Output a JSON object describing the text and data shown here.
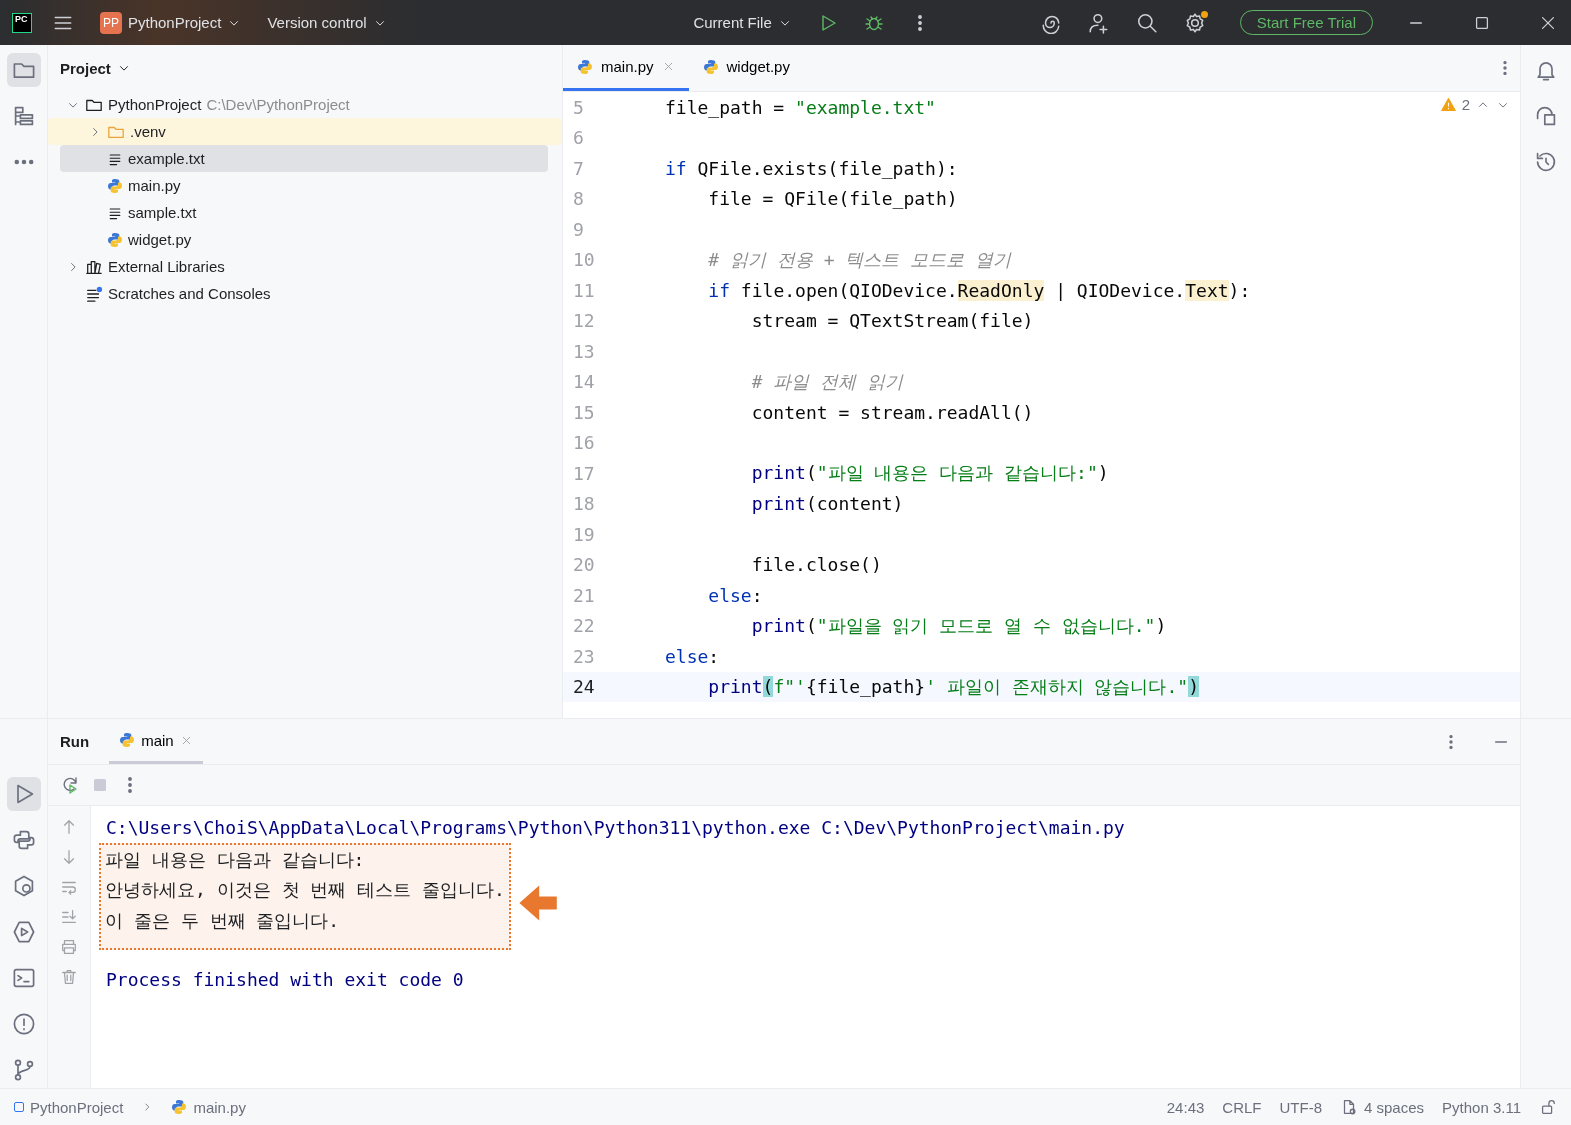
{
  "title_bar": {
    "app_logo": "PC",
    "project_badge": "PP",
    "project": "PythonProject",
    "vcs": "Version control",
    "run_config": "Current File",
    "trial_button": "Start Free Trial"
  },
  "project_panel": {
    "title": "Project",
    "tree": [
      {
        "name": "PythonProject",
        "path": "C:\\Dev\\PythonProject",
        "kind": "project",
        "expanded": true,
        "selected": false,
        "highlighted": false,
        "children": [
          {
            "name": ".venv",
            "kind": "folder",
            "expanded": false,
            "selected": false,
            "highlighted": true
          },
          {
            "name": "example.txt",
            "kind": "text",
            "selected": true,
            "highlighted": false
          },
          {
            "name": "main.py",
            "kind": "python",
            "selected": false,
            "highlighted": false
          },
          {
            "name": "sample.txt",
            "kind": "text",
            "selected": false,
            "highlighted": false
          },
          {
            "name": "widget.py",
            "kind": "python",
            "selected": false,
            "highlighted": false
          }
        ]
      },
      {
        "name": "External Libraries",
        "kind": "library",
        "expanded": false,
        "selected": false,
        "highlighted": false
      },
      {
        "name": "Scratches and Consoles",
        "kind": "scratch",
        "selected": false,
        "highlighted": false
      }
    ]
  },
  "editor": {
    "tabs": [
      {
        "label": "main.py",
        "selected": true,
        "closable": true
      },
      {
        "label": "widget.py",
        "selected": false,
        "closable": false
      }
    ],
    "warnings": "2",
    "lines": [
      {
        "number": "5",
        "current": false,
        "tokens": [
          {
            "kind": "plain",
            "text": "file_path = "
          },
          {
            "kind": "str",
            "text": "\"example.txt\""
          }
        ]
      },
      {
        "number": "6",
        "current": false
      },
      {
        "number": "7",
        "current": false,
        "tokens": [
          {
            "kind": "kw",
            "text": "if"
          },
          {
            "kind": "plain",
            "text": " QFile.exists(file_path):"
          }
        ]
      },
      {
        "number": "8",
        "current": false,
        "tokens": [
          {
            "kind": "plain",
            "text": "    file = QFile(file_path)"
          }
        ]
      },
      {
        "number": "9",
        "current": false
      },
      {
        "number": "10",
        "current": false,
        "tokens": [
          {
            "kind": "comment",
            "text": "    # 읽기 전용 + 텍스트 모드로 열기"
          }
        ]
      },
      {
        "number": "11",
        "current": false,
        "tokens": [
          {
            "kind": "kw",
            "text": "    if"
          },
          {
            "kind": "plain",
            "text": " file.open(QIODevice."
          },
          {
            "kind": "mark",
            "text": "ReadOnly"
          },
          {
            "kind": "plain",
            "text": " | QIODevice."
          },
          {
            "kind": "mark",
            "text": "Text"
          },
          {
            "kind": "plain",
            "text": "):"
          }
        ]
      },
      {
        "number": "12",
        "current": false,
        "tokens": [
          {
            "kind": "plain",
            "text": "        stream = QTextStream(file)"
          }
        ]
      },
      {
        "number": "13",
        "current": false
      },
      {
        "number": "14",
        "current": false,
        "tokens": [
          {
            "kind": "comment",
            "text": "        # 파일 전체 읽기"
          }
        ]
      },
      {
        "number": "15",
        "current": false,
        "tokens": [
          {
            "kind": "plain",
            "text": "        content = stream.readAll()"
          }
        ]
      },
      {
        "number": "16",
        "current": false
      },
      {
        "number": "17",
        "current": false,
        "tokens": [
          {
            "kind": "builtin",
            "text": "        print"
          },
          {
            "kind": "plain",
            "text": "("
          },
          {
            "kind": "str",
            "text": "\"파일 내용은 다음과 같습니다:\""
          },
          {
            "kind": "plain",
            "text": ")"
          }
        ]
      },
      {
        "number": "18",
        "current": false,
        "tokens": [
          {
            "kind": "builtin",
            "text": "        print"
          },
          {
            "kind": "plain",
            "text": "(content)"
          }
        ]
      },
      {
        "number": "19",
        "current": false
      },
      {
        "number": "20",
        "current": false,
        "tokens": [
          {
            "kind": "plain",
            "text": "        file.close()"
          }
        ]
      },
      {
        "number": "21",
        "current": false,
        "tokens": [
          {
            "kind": "kw",
            "text": "    else"
          },
          {
            "kind": "plain",
            "text": ":"
          }
        ]
      },
      {
        "number": "22",
        "current": false,
        "tokens": [
          {
            "kind": "builtin",
            "text": "        print"
          },
          {
            "kind": "plain",
            "text": "("
          },
          {
            "kind": "str",
            "text": "\"파일을 읽기 모드로 열 수 없습니다.\""
          },
          {
            "kind": "plain",
            "text": ")"
          }
        ]
      },
      {
        "number": "23",
        "current": false,
        "tokens": [
          {
            "kind": "kw",
            "text": "else"
          },
          {
            "kind": "plain",
            "text": ":"
          }
        ]
      },
      {
        "number": "24",
        "current": true,
        "tokens": [
          {
            "kind": "builtin",
            "text": "    print"
          },
          {
            "kind": "brace",
            "text": "("
          },
          {
            "kind": "str",
            "text": "f\"'"
          },
          {
            "kind": "plain",
            "text": "{file_path}"
          },
          {
            "kind": "str",
            "text": "' 파일이 존재하지 않습니다.\""
          },
          {
            "kind": "brace",
            "text": ")"
          }
        ]
      }
    ]
  },
  "run_panel": {
    "title": "Run",
    "tabs": [
      {
        "label": "main",
        "selected": true
      }
    ],
    "command": "C:\\Users\\ChoiS\\AppData\\Local\\Programs\\Python\\Python311\\python.exe C:\\Dev\\PythonProject\\main.py",
    "highlighted_output": [
      "파일 내용은 다음과 같습니다:",
      "안녕하세요, 이것은 첫 번째 테스트 줄입니다.",
      "이 줄은 두 번째 줄입니다."
    ],
    "exit_message": "Process finished with exit code 0"
  },
  "status_bar": {
    "breadcrumbs": [
      {
        "label": "PythonProject",
        "kind": "project"
      },
      {
        "label": "main.py",
        "kind": "python"
      }
    ],
    "items": [
      "24:43",
      "CRLF",
      "UTF-8",
      "4 spaces",
      "Python 3.11"
    ]
  }
}
